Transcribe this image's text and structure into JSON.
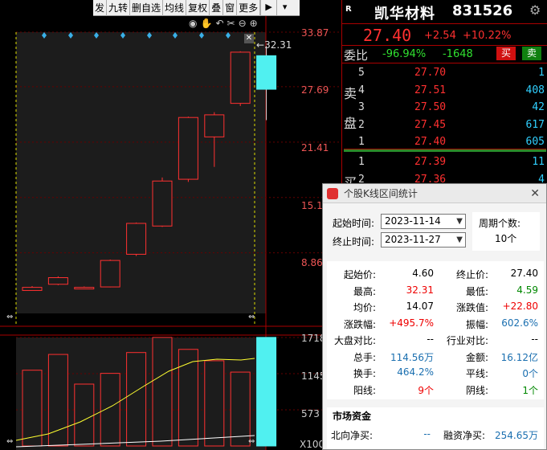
{
  "toolbar": {
    "items": [
      "发",
      "九转",
      "删自选",
      "均线",
      "复权",
      "叠",
      "窗",
      "更多"
    ],
    "icons": [
      "expand-right-icon",
      "dropdown-icon"
    ]
  },
  "chart": {
    "price_axis": [
      "33.87",
      "27.69",
      "21.41",
      "15.14",
      "8.86"
    ],
    "high_marker": "32.31",
    "volume_axis": [
      "1718",
      "1145",
      "573",
      "X100"
    ],
    "candles": [
      {
        "open": 4.6,
        "close": 4.95,
        "high": 5.1,
        "low": 4.59
      },
      {
        "open": 5.3,
        "close": 6.05,
        "high": 6.2,
        "low": 5.2
      },
      {
        "open": 4.95,
        "close": 4.8,
        "high": 5.05,
        "low": 4.75
      },
      {
        "open": 5.0,
        "close": 8.0,
        "high": 8.1,
        "low": 4.95
      },
      {
        "open": 8.7,
        "close": 12.2,
        "high": 12.3,
        "low": 8.5
      },
      {
        "open": 11.9,
        "close": 17.0,
        "high": 17.4,
        "low": 11.8
      },
      {
        "open": 17.2,
        "close": 24.2,
        "high": 24.3,
        "low": 16.9
      },
      {
        "open": 22.0,
        "close": 24.5,
        "high": 24.8,
        "low": 18.6
      },
      {
        "open": 25.8,
        "close": 31.6,
        "high": 31.7,
        "low": 25.5
      },
      {
        "open": 27.4,
        "close": 31.2,
        "high": 32.31,
        "low": 23.9
      }
    ],
    "volumes": [
      1200,
      1450,
      980,
      1150,
      1480,
      1720,
      1530,
      1350,
      1170,
      1720
    ],
    "colors": {
      "up": "#ff3030",
      "down": "#00e0e0",
      "ma": "#ffff30",
      "highlight": "#50f0f0"
    }
  },
  "header": {
    "r_badge": "R",
    "stock_name": "凯华材料",
    "stock_code": "831526",
    "price": "27.40",
    "change": "+2.54",
    "pct": "+10.22%",
    "weibi_label": "委比",
    "weibi_pct": "-96.94%",
    "weibi_diff": "-1648",
    "buy_btn": "买",
    "sell_btn": "卖"
  },
  "orderbook": {
    "sell_label_1": "卖",
    "sell_label_2": "盘",
    "buy_label": "买",
    "sells": [
      {
        "level": "5",
        "price": "27.70",
        "vol": "1"
      },
      {
        "level": "4",
        "price": "27.51",
        "vol": "408"
      },
      {
        "level": "3",
        "price": "27.50",
        "vol": "42"
      },
      {
        "level": "2",
        "price": "27.45",
        "vol": "617"
      },
      {
        "level": "1",
        "price": "27.40",
        "vol": "605"
      }
    ],
    "buys": [
      {
        "level": "1",
        "price": "27.39",
        "vol": "11"
      },
      {
        "level": "2",
        "price": "27.36",
        "vol": "4"
      }
    ]
  },
  "dialog": {
    "title": "个股K线区间统计",
    "start_label": "起始时间:",
    "start_value": "2023-11-14",
    "end_label": "终止时间:",
    "end_value": "2023-11-27",
    "period_label": "周期个数:",
    "period_value": "10个",
    "stats": [
      {
        "l1": "起始价:",
        "v1": "4.60",
        "c1": "#000",
        "l2": "终止价:",
        "v2": "27.40",
        "c2": "#000"
      },
      {
        "l1": "最高:",
        "v1": "32.31",
        "c1": "#e00",
        "l2": "最低:",
        "v2": "4.59",
        "c2": "#080"
      },
      {
        "l1": "均价:",
        "v1": "14.07",
        "c1": "#000",
        "l2": "涨跌值:",
        "v2": "+22.80",
        "c2": "#e00"
      },
      {
        "l1": "涨跌幅:",
        "v1": "+495.7%",
        "c1": "#e00",
        "l2": "振幅:",
        "v2": "602.6%",
        "c2": "#1a6fb0"
      },
      {
        "l1": "大盘对比:",
        "v1": "--",
        "c1": "#000",
        "l2": "行业对比:",
        "v2": "--",
        "c2": "#000"
      },
      {
        "l1": "总手:",
        "v1": "114.56万",
        "c1": "#1a6fb0",
        "l2": "金额:",
        "v2": "16.12亿",
        "c2": "#1a6fb0"
      },
      {
        "l1": "换手:",
        "v1": "464.2%",
        "c1": "#1a6fb0",
        "l2": "平线:",
        "v2": "0个",
        "c2": "#1a6fb0"
      },
      {
        "l1": "阳线:",
        "v1": "9个",
        "c1": "#e00",
        "l2": "阴线:",
        "v2": "1个",
        "c2": "#080"
      }
    ],
    "section_title": "市场资金",
    "north_label": "北向净买:",
    "north_value": "--",
    "margin_label": "融资净买:",
    "margin_value": "254.65万"
  }
}
